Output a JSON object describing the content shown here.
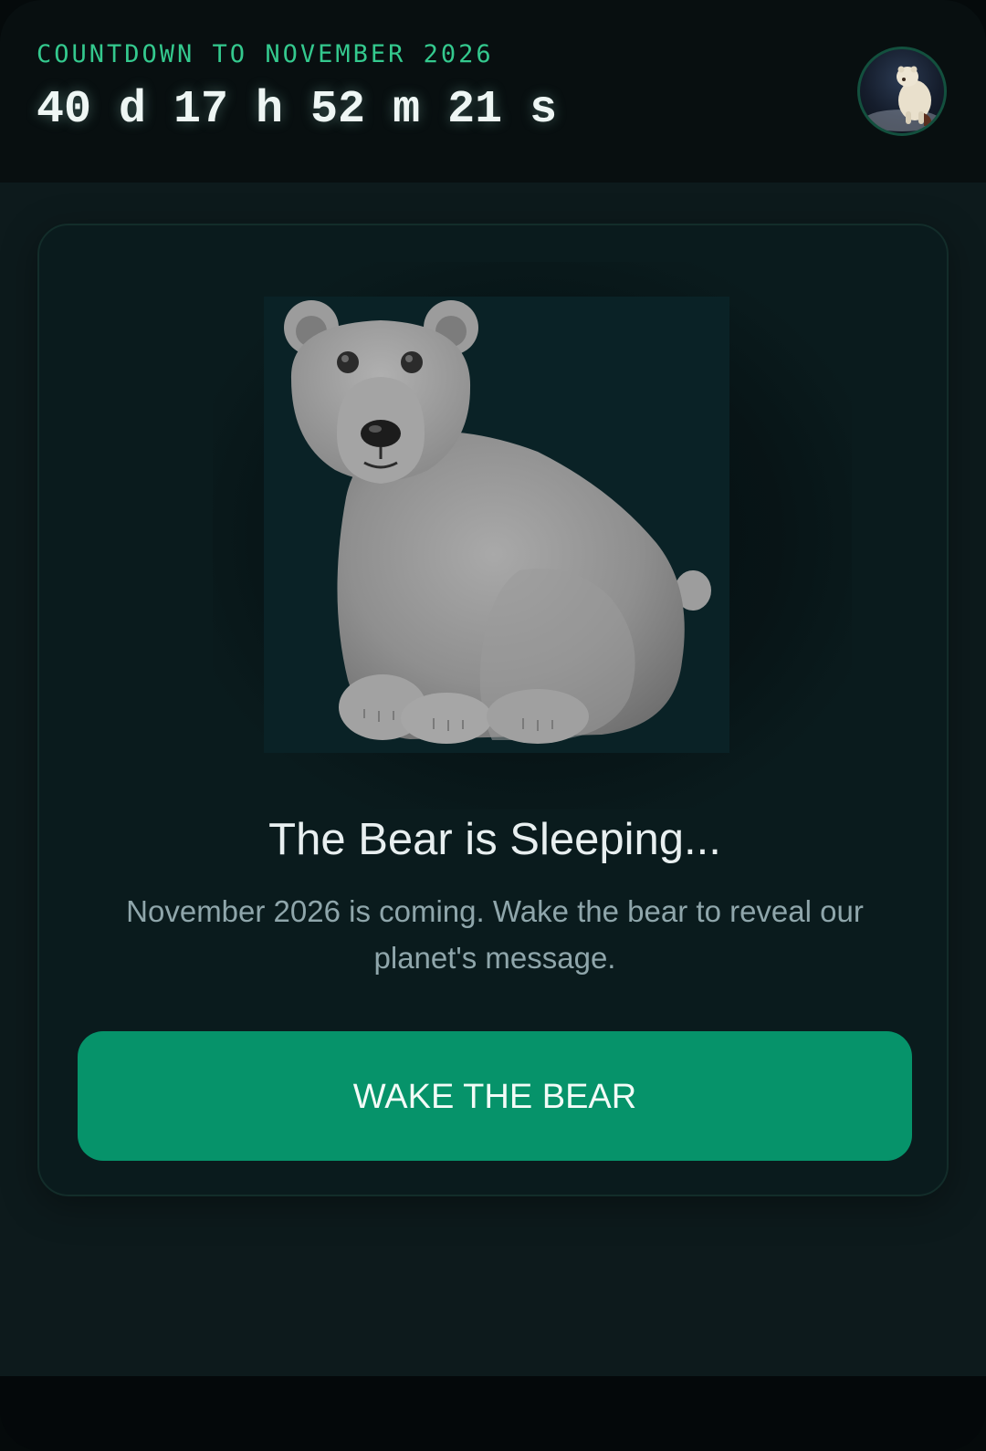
{
  "header": {
    "eyebrow": "COUNTDOWN TO NOVEMBER 2026",
    "countdown": "40 d 17 h 52 m 21 s"
  },
  "card": {
    "title": "The Bear is Sleeping...",
    "description": "November 2026 is coming. Wake the bear to reveal our planet's message.",
    "button_label": "WAKE THE BEAR"
  },
  "icons": {
    "avatar": "polar-bear-icon",
    "hero": "polar-bear-icon"
  },
  "colors": {
    "accent": "#34c98e",
    "button": "#06936a",
    "background": "#0d1a1c"
  }
}
